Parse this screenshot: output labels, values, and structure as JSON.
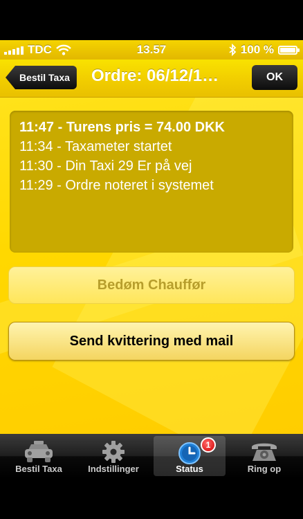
{
  "statusbar": {
    "carrier": "TDC",
    "time": "13.57",
    "battery_percent": 100,
    "battery_label": "100 %"
  },
  "navbar": {
    "back_label": "Bestil Taxa",
    "title": "Ordre: 06/12/1…",
    "ok_label": "OK"
  },
  "log": {
    "lines": [
      "11:47 - Turens pris = 74.00 DKK",
      "11:34 - Taxameter startet",
      "11:30 - Din Taxi 29 Er på vej",
      "11:29 - Ordre noteret i systemet"
    ]
  },
  "buttons": {
    "rate_label": "Bedøm Chauffør",
    "mail_label": "Send kvittering med mail"
  },
  "tabs": [
    {
      "label": "Bestil Taxa",
      "icon": "taxi-icon"
    },
    {
      "label": "Indstillinger",
      "icon": "gear-icon"
    },
    {
      "label": "Status",
      "icon": "clock-icon",
      "badge": "1"
    },
    {
      "label": "Ring op",
      "icon": "phone-icon"
    }
  ],
  "colors": {
    "accent": "#ffd800",
    "log_box": "#c9aa00",
    "badge": "#d10000"
  }
}
